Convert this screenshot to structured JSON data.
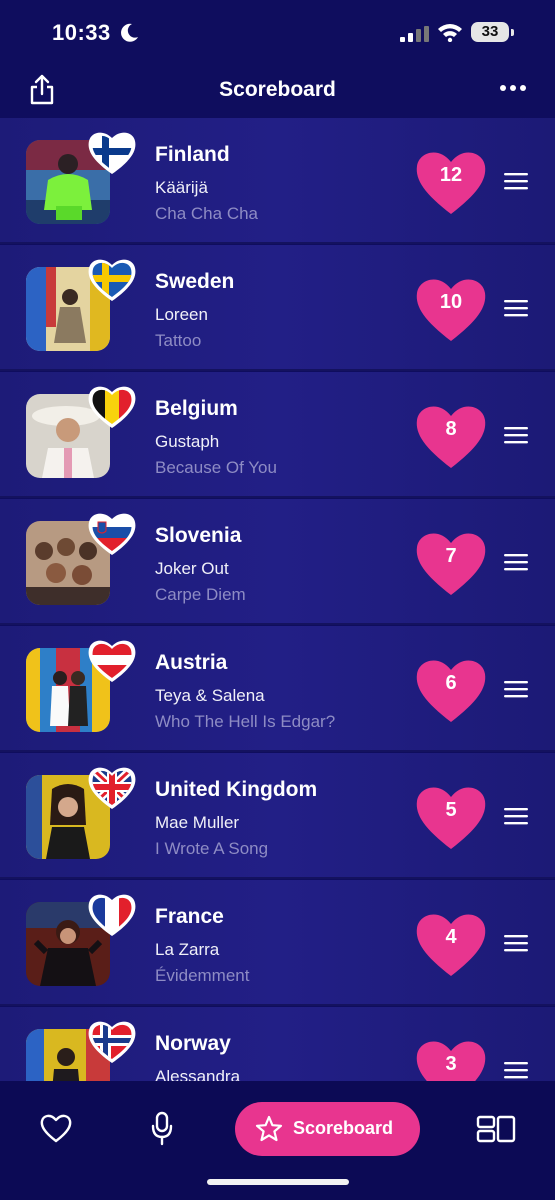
{
  "status": {
    "time": "10:33",
    "battery": "33"
  },
  "header": {
    "title": "Scoreboard"
  },
  "entries": [
    {
      "country": "Finland",
      "artist": "Käärijä",
      "song": "Cha Cha Cha",
      "points": "12",
      "flag": "finland-flag"
    },
    {
      "country": "Sweden",
      "artist": "Loreen",
      "song": "Tattoo",
      "points": "10",
      "flag": "sweden-flag"
    },
    {
      "country": "Belgium",
      "artist": "Gustaph",
      "song": "Because Of You",
      "points": "8",
      "flag": "belgium-flag"
    },
    {
      "country": "Slovenia",
      "artist": "Joker Out",
      "song": "Carpe Diem",
      "points": "7",
      "flag": "slovenia-flag"
    },
    {
      "country": "Austria",
      "artist": "Teya & Salena",
      "song": "Who The Hell Is Edgar?",
      "points": "6",
      "flag": "austria-flag"
    },
    {
      "country": "United Kingdom",
      "artist": "Mae Muller",
      "song": "I Wrote A Song",
      "points": "5",
      "flag": "uk-flag"
    },
    {
      "country": "France",
      "artist": "La Zarra",
      "song": "Évidemment",
      "points": "4",
      "flag": "france-flag"
    },
    {
      "country": "Norway",
      "artist": "Alessandra",
      "song": "",
      "points": "3",
      "flag": "norway-flag"
    }
  ],
  "tabbar": {
    "active_label": "Scoreboard"
  },
  "colors": {
    "background": "#0f0d5e",
    "row": "#201e80",
    "accent_pink": "#e8358f",
    "muted_text": "#8e8cc4"
  }
}
